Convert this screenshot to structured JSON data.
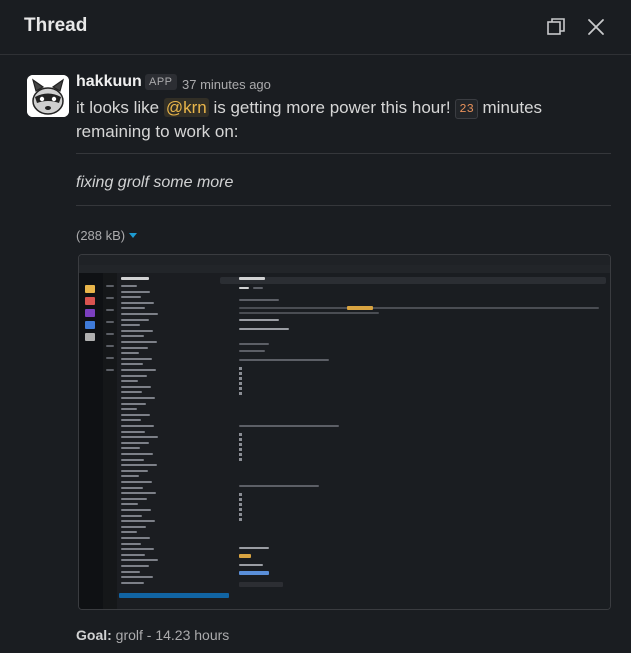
{
  "header": {
    "title": "Thread",
    "expand_icon": "expand-window-icon",
    "close_icon": "close-icon"
  },
  "message": {
    "sender": "hakkuun",
    "badge": "APP",
    "timestamp": "37 minutes ago",
    "text_before": "it looks like ",
    "mention": "@krn",
    "text_middle": " is getting more power this hour! ",
    "minutes": "23",
    "text_after": " minutes remaining to work on:",
    "task": "fixing grolf some more",
    "file_size": "(288 kB)",
    "goal_label": "Goal:",
    "goal_value": " grolf - 14.23 hours"
  },
  "colors": {
    "background": "#1a1d21",
    "mention": "#e8b54a",
    "caret": "#1d9bd1"
  }
}
